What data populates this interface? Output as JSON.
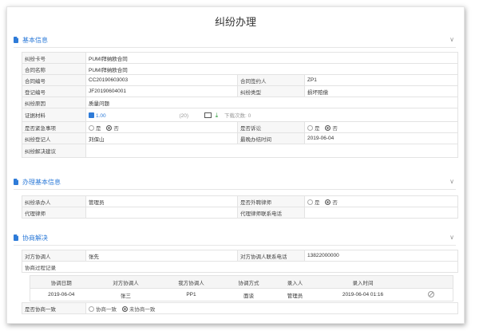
{
  "page": {
    "title": "纠纷办理"
  },
  "basic": {
    "section_title": "基本信息",
    "dispute_no_label": "纠纷卡号",
    "dispute_no": "PUMI拜纳欧合同",
    "contract_name_label": "合同名称",
    "contract_name": "PUMI拜纳欧合同",
    "contract_no_label": "合同编号",
    "contract_no": "CC20190603003",
    "signer_label": "合同签约人",
    "signer": "ZP1",
    "reg_no_label": "登记编号",
    "reg_no": "JF20190604001",
    "dispute_type_label": "纠纷类型",
    "dispute_type": "损坏赔偿",
    "reason_label": "纠纷原因",
    "reason": "质量问题",
    "evidence_label": "证据材料",
    "evidence_file": "1.00",
    "evidence_size": "(20)",
    "download_count": "下载次数: 0",
    "urgent_label": "是否紧急事项",
    "litigation_label": "是否诉讼",
    "registrant_label": "纠纷登记人",
    "registrant": "刘保山",
    "deadline_label": "最晚办结时间",
    "deadline": "2019-06-04",
    "suggest_label": "纠纷解决建议",
    "suggest": "",
    "yes": "是",
    "no": "否"
  },
  "handling": {
    "section_title": "办理基本信息",
    "handler_label": "纠纷承办人",
    "handler": "管理员",
    "outside_label": "是否外聘律师",
    "lawyer_label": "代理律师",
    "lawyer": "",
    "lawyer_phone_label": "代理律师联系电话",
    "lawyer_phone": "",
    "yes": "是",
    "no": "否"
  },
  "negotiation": {
    "section_title": "协商解决",
    "party_label": "对方协调人",
    "party": "张先",
    "party_phone_label": "对方协调人联系电话",
    "party_phone": "13822000000",
    "records_label": "协商过程记录",
    "columns": [
      "协调日期",
      "对方协调人",
      "我方协调人",
      "协调方式",
      "录入人",
      "录入时间"
    ],
    "rows": [
      [
        "2019-06-04",
        "张三",
        "PP1",
        "面谈",
        "管理员",
        "2019-06-04 01:16"
      ]
    ],
    "agree_label": "是否协商一致",
    "agree_yes": "协商一致",
    "agree_no": "未协商一致"
  }
}
